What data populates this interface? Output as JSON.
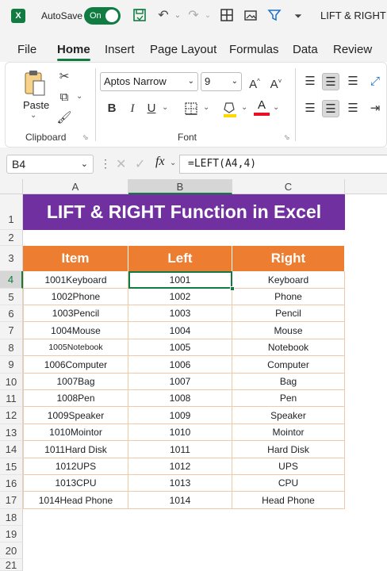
{
  "titlebar": {
    "app_icon": "X",
    "autosave_label": "AutoSave",
    "autosave_state": "On",
    "doc_title": "LIFT & RIGHT F",
    "icons": [
      "save-icon",
      "undo-icon",
      "redo-icon",
      "table-icon",
      "picture-icon",
      "filter-icon",
      "customize-icon"
    ]
  },
  "tabs": [
    "File",
    "Home",
    "Insert",
    "Page Layout",
    "Formulas",
    "Data",
    "Review"
  ],
  "ribbon": {
    "clipboard": {
      "paste_label": "Paste",
      "group_label": "Clipboard"
    },
    "font": {
      "font_name": "Aptos Narrow",
      "font_size": "9",
      "bold": "B",
      "italic": "I",
      "underline": "U",
      "grow": "A^",
      "shrink": "A˅",
      "group_label": "Font",
      "fill_color": "#ffd800",
      "font_color": "#e81123"
    }
  },
  "formula_bar": {
    "name_box": "B4",
    "fx": "fx",
    "formula": "=LEFT(A4,4)"
  },
  "sheet": {
    "columns": [
      "A",
      "B",
      "C"
    ],
    "row_numbers": [
      "1",
      "2",
      "3",
      "4",
      "5",
      "6",
      "7",
      "8",
      "9",
      "10",
      "11",
      "12",
      "13",
      "14",
      "15",
      "16",
      "17",
      "18",
      "19",
      "20",
      "21"
    ],
    "title": "LIFT & RIGHT Function in Excel",
    "title_color": "#7030a0",
    "header_color": "#ed7d31",
    "headers": [
      "Item",
      "Left",
      "Right"
    ],
    "rows": [
      [
        "1001Keyboard",
        "1001",
        "Keyboard"
      ],
      [
        "1002Phone",
        "1002",
        "Phone"
      ],
      [
        "1003Pencil",
        "1003",
        "Pencil"
      ],
      [
        "1004Mouse",
        "1004",
        "Mouse"
      ],
      [
        "1005Notebook",
        "1005",
        "Notebook"
      ],
      [
        "1006Computer",
        "1006",
        "Computer"
      ],
      [
        "1007Bag",
        "1007",
        "Bag"
      ],
      [
        "1008Pen",
        "1008",
        "Pen"
      ],
      [
        "1009Speaker",
        "1009",
        "Speaker"
      ],
      [
        "1010Mointor",
        "1010",
        "Mointor"
      ],
      [
        "1011Hard Disk",
        "1011",
        "Hard Disk"
      ],
      [
        "1012UPS",
        "1012",
        "UPS"
      ],
      [
        "1013CPU",
        "1013",
        "CPU"
      ],
      [
        "1014Head Phone",
        "1014",
        "Head Phone"
      ]
    ],
    "selected_cell": "B4"
  }
}
